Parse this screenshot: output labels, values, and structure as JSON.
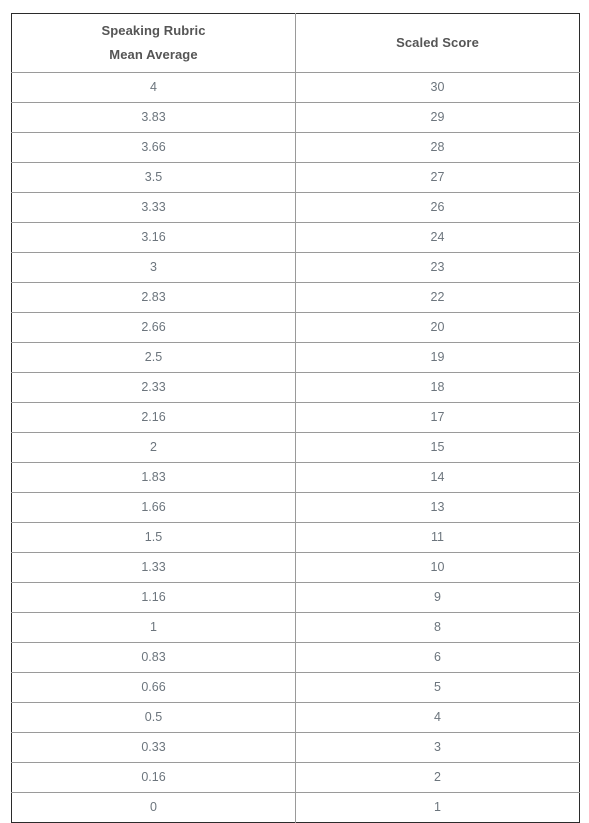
{
  "table": {
    "columns": [
      {
        "id": "speaking-rubric-mean-average",
        "lines": [
          "Speaking Rubric",
          "Mean Average"
        ]
      },
      {
        "id": "scaled-score",
        "lines": [
          "Scaled Score"
        ]
      }
    ],
    "rows": [
      {
        "mean_average": "4",
        "scaled_score": "30"
      },
      {
        "mean_average": "3.83",
        "scaled_score": "29"
      },
      {
        "mean_average": "3.66",
        "scaled_score": "28"
      },
      {
        "mean_average": "3.5",
        "scaled_score": "27"
      },
      {
        "mean_average": "3.33",
        "scaled_score": "26"
      },
      {
        "mean_average": "3.16",
        "scaled_score": "24"
      },
      {
        "mean_average": "3",
        "scaled_score": "23"
      },
      {
        "mean_average": "2.83",
        "scaled_score": "22"
      },
      {
        "mean_average": "2.66",
        "scaled_score": "20"
      },
      {
        "mean_average": "2.5",
        "scaled_score": "19"
      },
      {
        "mean_average": "2.33",
        "scaled_score": "18"
      },
      {
        "mean_average": "2.16",
        "scaled_score": "17"
      },
      {
        "mean_average": "2",
        "scaled_score": "15"
      },
      {
        "mean_average": "1.83",
        "scaled_score": "14"
      },
      {
        "mean_average": "1.66",
        "scaled_score": "13"
      },
      {
        "mean_average": "1.5",
        "scaled_score": "11"
      },
      {
        "mean_average": "1.33",
        "scaled_score": "10"
      },
      {
        "mean_average": "1.16",
        "scaled_score": "9"
      },
      {
        "mean_average": "1",
        "scaled_score": "8"
      },
      {
        "mean_average": "0.83",
        "scaled_score": "6"
      },
      {
        "mean_average": "0.66",
        "scaled_score": "5"
      },
      {
        "mean_average": "0.5",
        "scaled_score": "4"
      },
      {
        "mean_average": "0.33",
        "scaled_score": "3"
      },
      {
        "mean_average": "0.16",
        "scaled_score": "2"
      },
      {
        "mean_average": "0",
        "scaled_score": "1"
      }
    ]
  },
  "colors": {
    "header_text": "#555555",
    "cell_text": "#6c757d",
    "outer_border": "#2b2b2b",
    "inner_border": "#9a9a9a",
    "background": "#ffffff"
  }
}
